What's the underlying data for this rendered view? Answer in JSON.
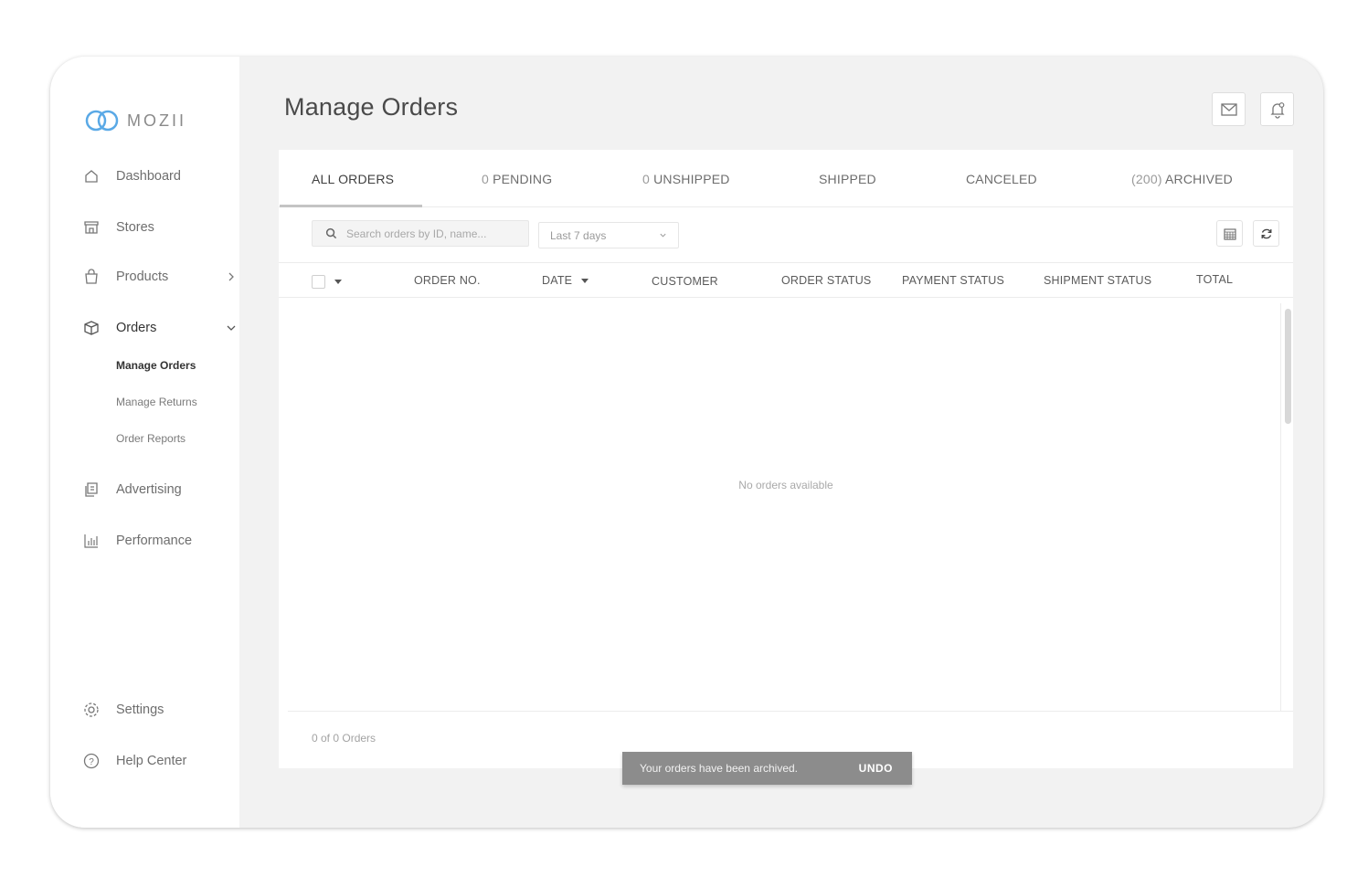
{
  "brand": {
    "name": "MOZII"
  },
  "sidebar": {
    "items": [
      {
        "label": "Dashboard",
        "icon": "home-icon"
      },
      {
        "label": "Stores",
        "icon": "store-icon"
      },
      {
        "label": "Products",
        "icon": "bag-icon"
      },
      {
        "label": "Orders",
        "icon": "box-icon"
      },
      {
        "label": "Advertising",
        "icon": "copy-icon"
      },
      {
        "label": "Performance",
        "icon": "bar-chart-icon"
      },
      {
        "label": "Settings",
        "icon": "gear-icon"
      },
      {
        "label": "Help Center",
        "icon": "help-icon"
      }
    ],
    "orders_sub": [
      "Manage Orders",
      "Manage Returns",
      "Order Reports"
    ]
  },
  "header": {
    "title": "Manage Orders"
  },
  "tabs": [
    {
      "count": "",
      "label": "ALL ORDERS"
    },
    {
      "count": "0",
      "label": "PENDING"
    },
    {
      "count": "0",
      "label": "UNSHIPPED"
    },
    {
      "count": "",
      "label": "SHIPPED"
    },
    {
      "count": "",
      "label": "CANCELED"
    },
    {
      "count": "(200)",
      "label": "ARCHIVED"
    }
  ],
  "filters": {
    "search_placeholder": "Search orders by ID, name...",
    "date_range": "Last 7 days"
  },
  "table": {
    "columns": [
      "ORDER NO.",
      "DATE",
      "CUSTOMER",
      "ORDER STATUS",
      "PAYMENT STATUS",
      "SHIPMENT STATUS",
      "TOTAL"
    ],
    "empty_message": "No orders available",
    "footer": "0 of 0 Orders"
  },
  "toast": {
    "message": "Your orders have been archived.",
    "action": "UNDO"
  },
  "colors": {
    "accent": "#5aa9e6",
    "toast_bg": "#8c8c8c",
    "background": "#f2f2f2"
  }
}
